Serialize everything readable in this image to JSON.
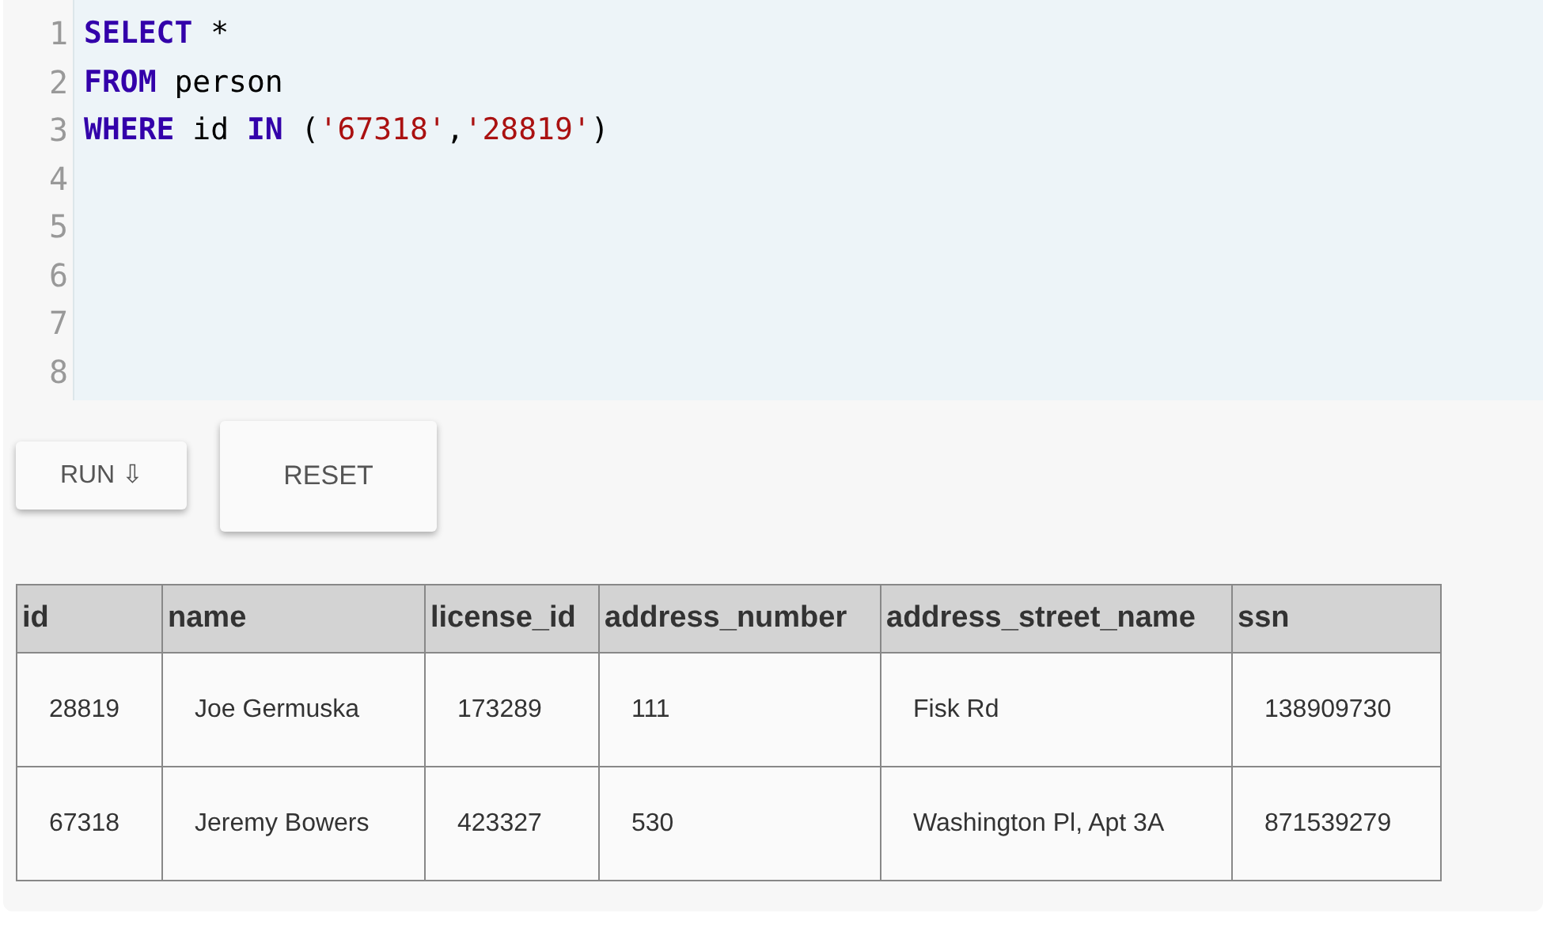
{
  "editor": {
    "lines": [
      {
        "number": "1",
        "tokens": [
          {
            "kind": "keyword",
            "text": "SELECT"
          },
          {
            "kind": "plain",
            "text": " *"
          }
        ]
      },
      {
        "number": "2",
        "tokens": [
          {
            "kind": "keyword",
            "text": "FROM"
          },
          {
            "kind": "plain",
            "text": " person"
          }
        ]
      },
      {
        "number": "3",
        "tokens": [
          {
            "kind": "keyword",
            "text": "WHERE"
          },
          {
            "kind": "plain",
            "text": " id "
          },
          {
            "kind": "keyword",
            "text": "IN"
          },
          {
            "kind": "plain",
            "text": " ("
          },
          {
            "kind": "string",
            "text": "'67318'"
          },
          {
            "kind": "plain",
            "text": ","
          },
          {
            "kind": "string",
            "text": "'28819'"
          },
          {
            "kind": "plain",
            "text": ")"
          }
        ]
      },
      {
        "number": "4"
      },
      {
        "number": "5"
      },
      {
        "number": "6"
      },
      {
        "number": "7"
      },
      {
        "number": "8"
      }
    ]
  },
  "buttons": [
    {
      "label": "RUN ⇩",
      "kind": "run"
    },
    {
      "label": "RESET",
      "kind": "reset"
    }
  ],
  "table": {
    "columns": [
      "id",
      "name",
      "license_id",
      "address_number",
      "address_street_name",
      "ssn"
    ],
    "rows": [
      [
        "28819",
        "Joe Germuska",
        "173289",
        "111",
        "Fisk Rd",
        "138909730"
      ],
      [
        "67318",
        "Jeremy Bowers",
        "423327",
        "530",
        "Washington Pl, Apt 3A",
        "871539279"
      ]
    ]
  }
}
